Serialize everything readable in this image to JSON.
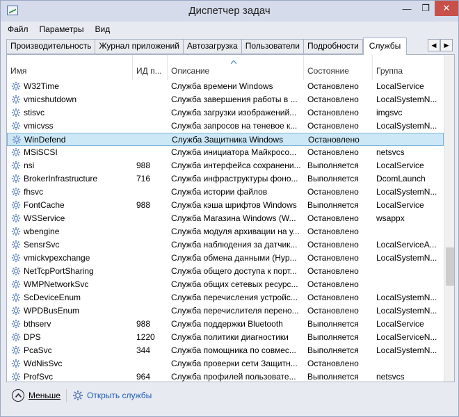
{
  "window": {
    "title": "Диспетчер задач"
  },
  "titlebar": {
    "minimize": "—",
    "maximize": "❐",
    "close": "✕"
  },
  "menu": [
    "Файл",
    "Параметры",
    "Вид"
  ],
  "tabs": [
    {
      "label": "Производительность"
    },
    {
      "label": "Журнал приложений"
    },
    {
      "label": "Автозагрузка"
    },
    {
      "label": "Пользователи"
    },
    {
      "label": "Подробности"
    },
    {
      "label": "Службы",
      "active": true
    }
  ],
  "tab_scroll": {
    "left": "◀",
    "right": "▶"
  },
  "columns": {
    "name": "Имя",
    "pid": "ИД п...",
    "description": "Описание",
    "state": "Состояние",
    "group": "Группа"
  },
  "rows": [
    {
      "name": "W32Time",
      "pid": "",
      "description": "Служба времени Windows",
      "state": "Остановлено",
      "group": "LocalService"
    },
    {
      "name": "vmicshutdown",
      "pid": "",
      "description": "Служба завершения работы в ...",
      "state": "Остановлено",
      "group": "LocalSystemN..."
    },
    {
      "name": "stisvc",
      "pid": "",
      "description": "Служба загрузки изображений...",
      "state": "Остановлено",
      "group": "imgsvc"
    },
    {
      "name": "vmicvss",
      "pid": "",
      "description": "Служба запросов на теневое к...",
      "state": "Остановлено",
      "group": "LocalSystemN..."
    },
    {
      "name": "WinDefend",
      "pid": "",
      "description": "Служба Защитника Windows",
      "state": "Остановлено",
      "group": "",
      "selected": true
    },
    {
      "name": "MSiSCSI",
      "pid": "",
      "description": "Служба инициатора Майкросо...",
      "state": "Остановлено",
      "group": "netsvcs"
    },
    {
      "name": "nsi",
      "pid": "988",
      "description": "Служба интерфейса сохранени...",
      "state": "Выполняется",
      "group": "LocalService"
    },
    {
      "name": "BrokerInfrastructure",
      "pid": "716",
      "description": "Служба инфраструктуры фоно...",
      "state": "Выполняется",
      "group": "DcomLaunch"
    },
    {
      "name": "fhsvc",
      "pid": "",
      "description": "Служба истории файлов",
      "state": "Остановлено",
      "group": "LocalSystemN..."
    },
    {
      "name": "FontCache",
      "pid": "988",
      "description": "Служба кэша шрифтов Windows",
      "state": "Выполняется",
      "group": "LocalService"
    },
    {
      "name": "WSService",
      "pid": "",
      "description": "Служба Магазина Windows (W...",
      "state": "Остановлено",
      "group": "wsappx"
    },
    {
      "name": "wbengine",
      "pid": "",
      "description": "Служба модуля архивации на у...",
      "state": "Остановлено",
      "group": ""
    },
    {
      "name": "SensrSvc",
      "pid": "",
      "description": "Служба наблюдения за датчик...",
      "state": "Остановлено",
      "group": "LocalServiceA..."
    },
    {
      "name": "vmickvpexchange",
      "pid": "",
      "description": "Служба обмена данными (Hyp...",
      "state": "Остановлено",
      "group": "LocalSystemN..."
    },
    {
      "name": "NetTcpPortSharing",
      "pid": "",
      "description": "Служба общего доступа к порт...",
      "state": "Остановлено",
      "group": ""
    },
    {
      "name": "WMPNetworkSvc",
      "pid": "",
      "description": "Служба общих сетевых ресурс...",
      "state": "Остановлено",
      "group": ""
    },
    {
      "name": "ScDeviceEnum",
      "pid": "",
      "description": "Служба перечисления устройс...",
      "state": "Остановлено",
      "group": "LocalSystemN..."
    },
    {
      "name": "WPDBusEnum",
      "pid": "",
      "description": "Служба перечислителя перено...",
      "state": "Остановлено",
      "group": "LocalSystemN..."
    },
    {
      "name": "bthserv",
      "pid": "988",
      "description": "Служба поддержки Bluetooth",
      "state": "Выполняется",
      "group": "LocalService"
    },
    {
      "name": "DPS",
      "pid": "1220",
      "description": "Служба политики диагностики",
      "state": "Выполняется",
      "group": "LocalServiceN..."
    },
    {
      "name": "PcaSvc",
      "pid": "344",
      "description": "Служба помощника по совмес...",
      "state": "Выполняется",
      "group": "LocalSystemN..."
    },
    {
      "name": "WdNisSvc",
      "pid": "",
      "description": "Служба проверки сети Защитн...",
      "state": "Остановлено",
      "group": ""
    },
    {
      "name": "ProfSvc",
      "pid": "964",
      "description": "Служба профилей пользовате...",
      "state": "Выполняется",
      "group": "netsvcs"
    }
  ],
  "footer": {
    "less_label": "Меньше",
    "open_services_label": "Открыть службы"
  },
  "colors": {
    "accent": "#1a5db8",
    "selection": "#cce8f6",
    "close": "#c7504a"
  }
}
